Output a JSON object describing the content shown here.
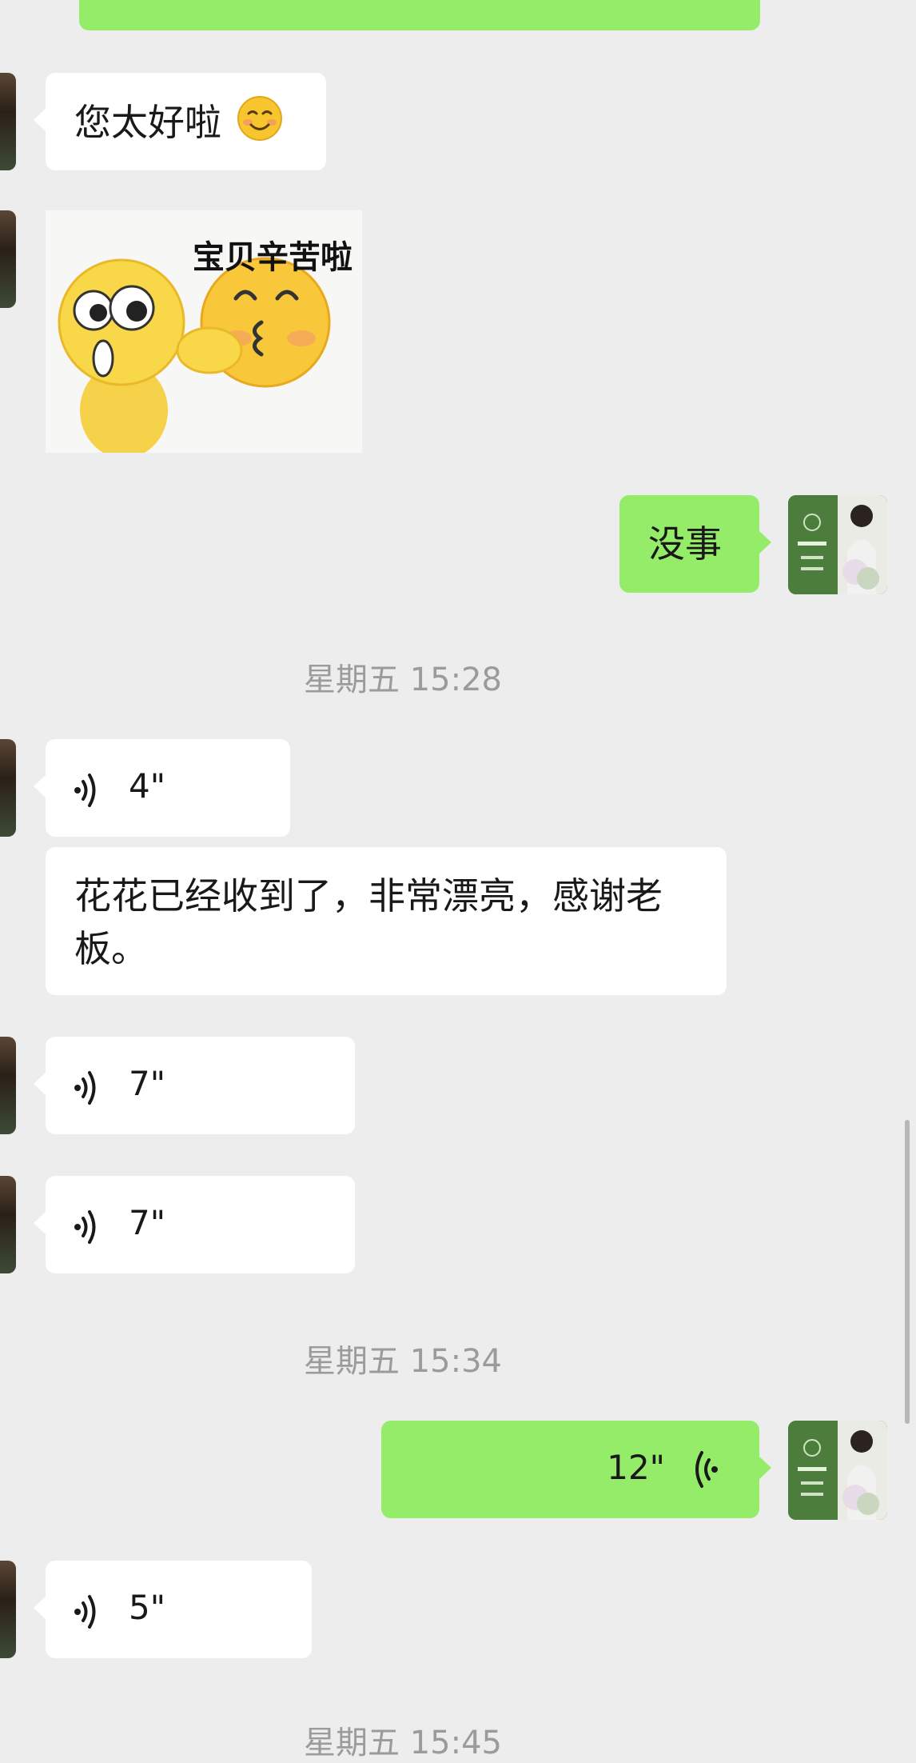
{
  "messages": {
    "reply_1": {
      "text": "您太好啦"
    },
    "sticker": {
      "caption": "宝贝辛苦啦"
    },
    "reply_2": {
      "text": "没事"
    },
    "time_1": "星期五 15:28",
    "voice_1": {
      "duration": "4\""
    },
    "text_1": {
      "text": "花花已经收到了，非常漂亮，感谢老板。"
    },
    "voice_2": {
      "duration": "7\""
    },
    "voice_3": {
      "duration": "7\""
    },
    "time_2": "星期五 15:34",
    "voice_out": {
      "duration": "12\""
    },
    "voice_4": {
      "duration": "5\""
    },
    "time_3_partial": "星期五 15:45"
  },
  "colors": {
    "background": "#ededed",
    "incoming_bubble": "#ffffff",
    "outgoing_bubble": "#95ec69",
    "timestamp_text": "#9b9b9b"
  },
  "icons": [
    "smile-emoji-icon",
    "voice-wave-icon",
    "avatar-icon"
  ]
}
